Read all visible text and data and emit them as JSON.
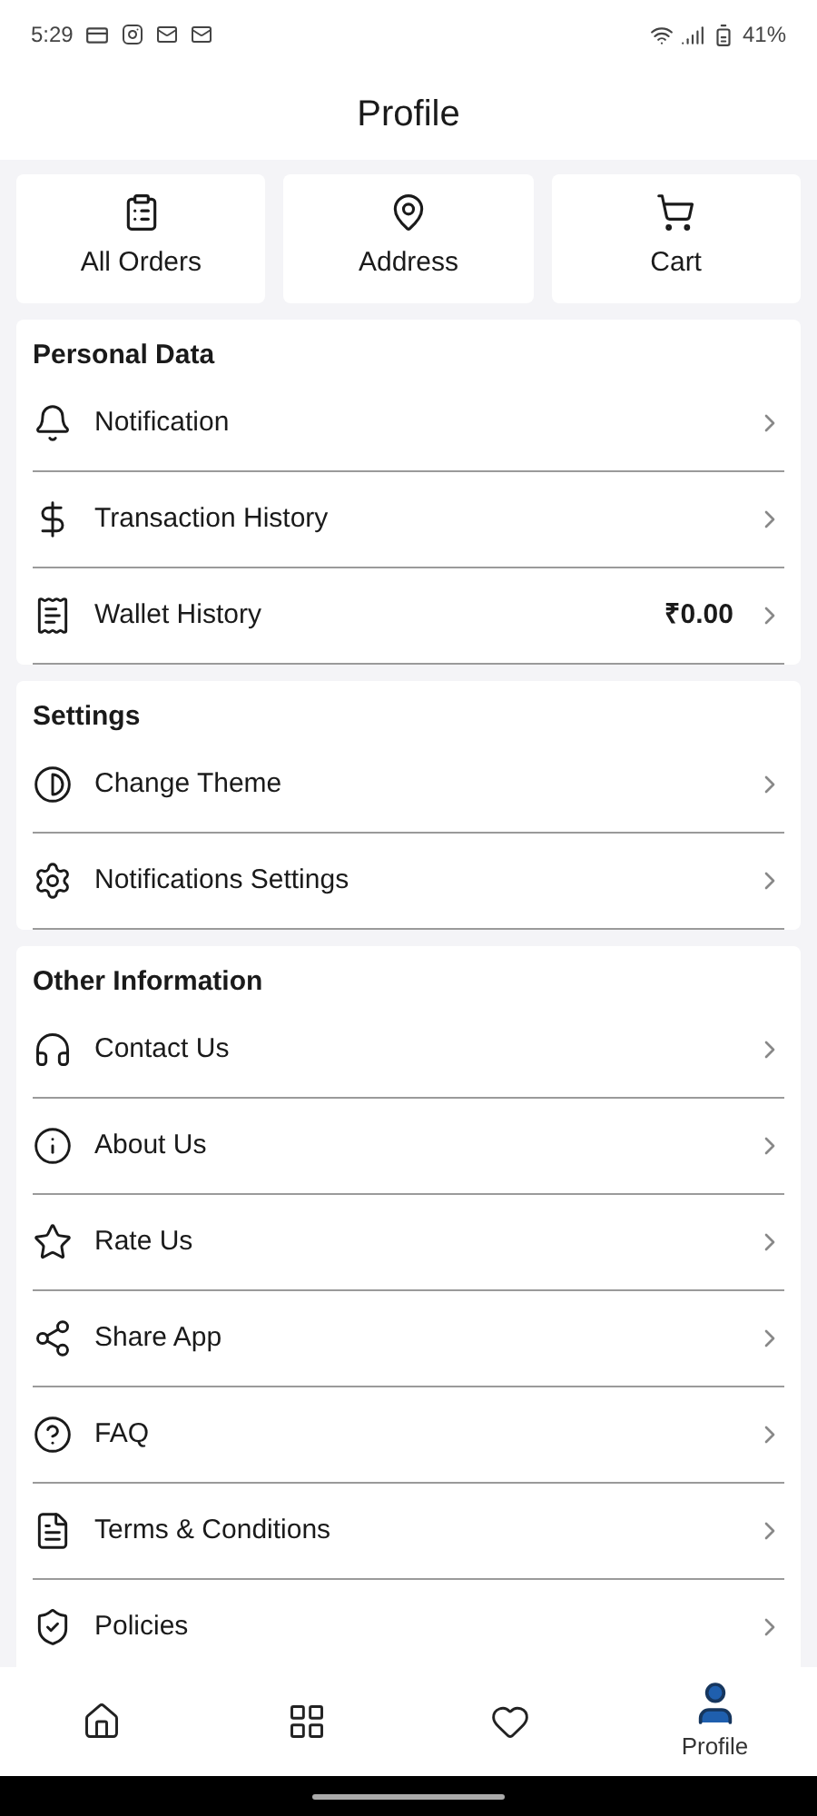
{
  "status_bar": {
    "time": "5:29",
    "battery": "41%"
  },
  "header": {
    "title": "Profile"
  },
  "quick_links": [
    {
      "label": "All Orders"
    },
    {
      "label": "Address"
    },
    {
      "label": "Cart"
    }
  ],
  "sections": [
    {
      "title": "Personal Data",
      "items": [
        {
          "label": "Notification"
        },
        {
          "label": "Transaction History"
        },
        {
          "label": "Wallet History",
          "value": "₹0.00"
        }
      ]
    },
    {
      "title": "Settings",
      "items": [
        {
          "label": "Change Theme"
        },
        {
          "label": "Notifications Settings"
        }
      ]
    },
    {
      "title": "Other Information",
      "items": [
        {
          "label": "Contact Us"
        },
        {
          "label": "About Us"
        },
        {
          "label": "Rate Us"
        },
        {
          "label": "Share App"
        },
        {
          "label": "FAQ"
        },
        {
          "label": "Terms & Conditions"
        },
        {
          "label": "Policies"
        }
      ]
    }
  ],
  "bottom_nav": [
    {
      "selected": false
    },
    {
      "selected": false
    },
    {
      "selected": false
    },
    {
      "label": "Profile",
      "selected": true
    }
  ]
}
